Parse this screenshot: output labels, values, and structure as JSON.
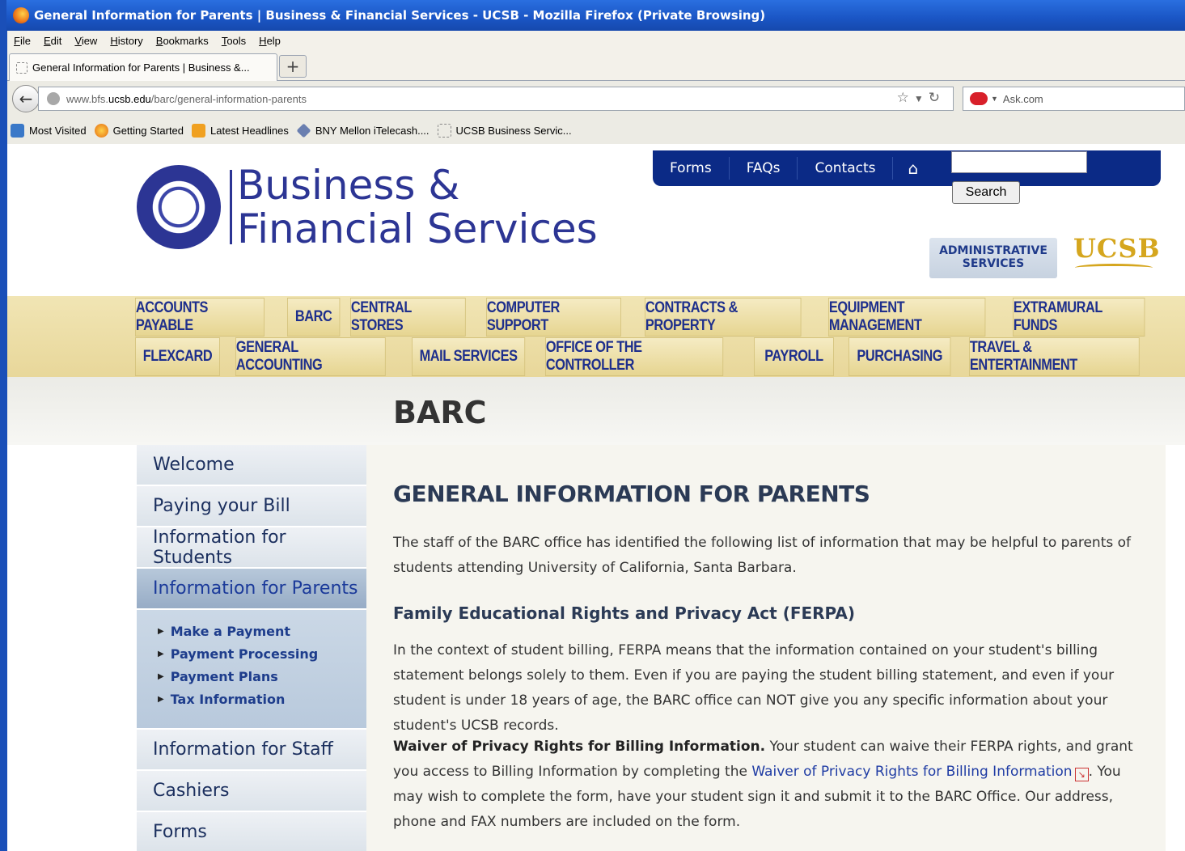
{
  "window": {
    "title": "General Information for Parents  |  Business & Financial Services - UCSB - Mozilla Firefox (Private Browsing)"
  },
  "menu": [
    "File",
    "Edit",
    "View",
    "History",
    "Bookmarks",
    "Tools",
    "Help"
  ],
  "tab": {
    "label": "General Information for Parents | Business &..."
  },
  "url": {
    "prefix": "www.bfs.",
    "domain": "ucsb.edu",
    "path": "/barc/general-information-parents"
  },
  "search_engine": {
    "label": "Ask.com"
  },
  "bookmarks": [
    "Most Visited",
    "Getting Started",
    "Latest Headlines",
    "BNY Mellon iTelecash....",
    "UCSB Business Servic..."
  ],
  "site": {
    "logo_line1": "Business &",
    "logo_line2": "Financial Services",
    "topnav": [
      "Forms",
      "FAQs",
      "Contacts"
    ],
    "search_button": "Search",
    "admin_badge_line1": "ADMINISTRATIVE",
    "admin_badge_line2": "SERVICES",
    "ucsb_logo": "UCSB"
  },
  "departments_row1": [
    "ACCOUNTS PAYABLE",
    "BARC",
    "CENTRAL STORES",
    "COMPUTER SUPPORT",
    "CONTRACTS & PROPERTY",
    "EQUIPMENT MANAGEMENT",
    "EXTRAMURAL FUNDS"
  ],
  "departments_row2": [
    "FLEXCARD",
    "GENERAL ACCOUNTING",
    "MAIL SERVICES",
    "OFFICE OF THE CONTROLLER",
    "PAYROLL",
    "PURCHASING",
    "TRAVEL & ENTERTAINMENT"
  ],
  "section_title": "BARC",
  "sidenav": {
    "items_top": [
      "Welcome",
      "Paying your Bill",
      "Information for Students"
    ],
    "active": "Information for Parents",
    "subitems": [
      "Make a Payment",
      "Payment Processing",
      "Payment Plans",
      "Tax Information"
    ],
    "items_bottom": [
      "Information for Staff",
      "Cashiers",
      "Forms"
    ]
  },
  "content": {
    "heading": "GENERAL INFORMATION FOR PARENTS",
    "intro": "The staff of the BARC office has identified the following list of information that may be helpful to parents of students attending University of California, Santa Barbara.",
    "ferpa_heading": "Family Educational Rights and Privacy Act (FERPA)",
    "ferpa_text": "In the context of student billing, FERPA means that the information contained on your student's billing statement belongs solely to them. Even if you are paying the student billing statement, and even if your student is under 18 years of age, the BARC office can NOT give you any specific information about your student's UCSB records.",
    "waiver_bold": "Waiver of Privacy Rights for Billing Information.",
    "waiver_text1": " Your student can waive their FERPA rights, and grant you access to Billing Information by completing the ",
    "waiver_link": "Waiver of Privacy Rights for Billing Information",
    "waiver_text2": ". You may wish to complete the form, have your student sign it and submit it to the BARC Office. Our address, phone and FAX numbers are included on the form."
  }
}
